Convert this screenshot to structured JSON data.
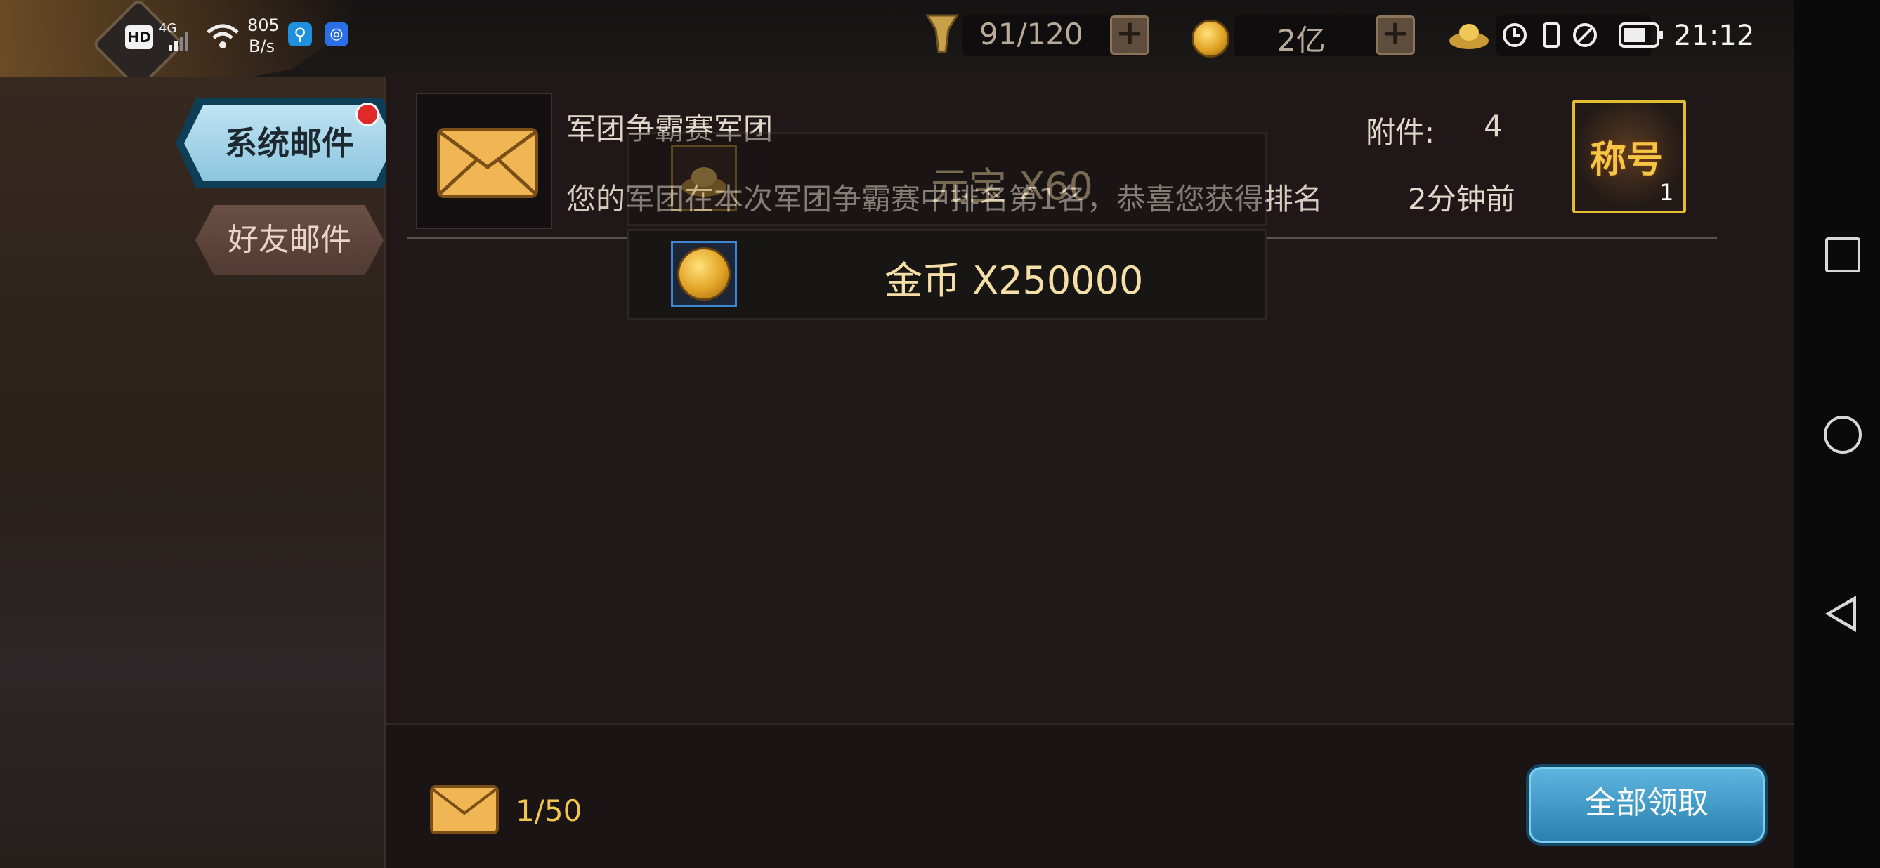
{
  "status_bar": {
    "hd": "HD",
    "net": "4G",
    "speed_value": "805",
    "speed_unit": "B/s",
    "time": "21:12"
  },
  "resources": {
    "stamina": "91/120",
    "gold": "2亿"
  },
  "tabs": {
    "system_mail": "系统邮件",
    "friend_mail": "好友邮件"
  },
  "mail": {
    "sender": "军团争霸赛军团",
    "preview": "您的军团在本次军团争霸赛中排名第1名，恭喜您获得排名",
    "attachment_label": "附件:",
    "attachment_count": "4",
    "time": "2分钟前",
    "title_item_label": "称号",
    "title_item_count": "1"
  },
  "rewards": [
    {
      "label": "元宝 X60"
    },
    {
      "label": "金币 X250000"
    }
  ],
  "footer": {
    "mail_count": "1/50",
    "claim_all": "全部领取"
  },
  "colors": {
    "accent_gold": "#f0c64e",
    "claim_button": "#3a93c2",
    "selected_tab": "#9fd2e7"
  }
}
